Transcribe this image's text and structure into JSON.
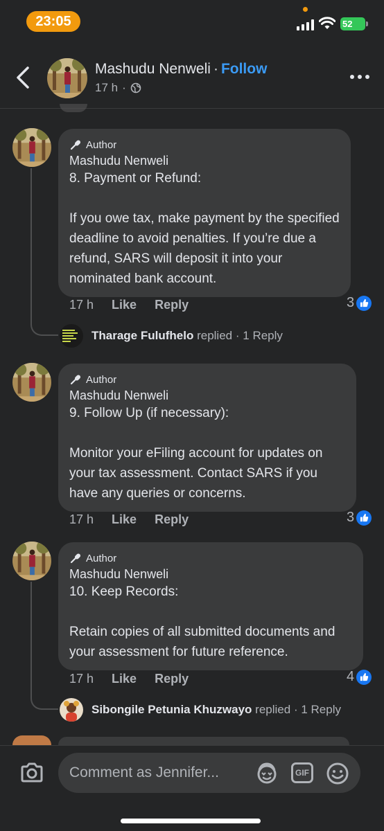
{
  "status_bar": {
    "time": "23:05",
    "battery": "52"
  },
  "header": {
    "name": "Mashudu Nenweli",
    "separator": "·",
    "follow_label": "Follow",
    "time_ago": "17 h",
    "meta_dot": "·",
    "audience_icon": "globe-icon"
  },
  "comments": [
    {
      "badge": "Author",
      "name": "Mashudu Nenweli",
      "text": "8. Payment or Refund:\n\nIf you owe tax, make payment by the specified deadline to avoid penalties. If you’re due a refund, SARS will deposit it into your nominated bank account.",
      "time": "17 h",
      "like_label": "Like",
      "reply_label": "Reply",
      "reactions": "3",
      "reply_summary": {
        "name": "Tharage Fulufhelo",
        "action": "replied",
        "dot": "·",
        "count": "1 Reply"
      }
    },
    {
      "badge": "Author",
      "name": "Mashudu Nenweli",
      "text": "9. Follow Up (if necessary):\n\nMonitor your eFiling account for updates on your tax assessment. Contact SARS if you have any queries or concerns.",
      "time": "17 h",
      "like_label": "Like",
      "reply_label": "Reply",
      "reactions": "3"
    },
    {
      "badge": "Author",
      "name": "Mashudu Nenweli",
      "text": "10. Keep Records:\n\nRetain copies of all submitted documents and your assessment for future reference.",
      "time": "17 h",
      "like_label": "Like",
      "reply_label": "Reply",
      "reactions": "4",
      "reply_summary": {
        "name": "Sibongile Petunia Khuzwayo",
        "action": "replied",
        "dot": "·",
        "count": "1 Reply"
      }
    }
  ],
  "composer": {
    "placeholder": "Comment as Jennifer...",
    "gif_label": "GIF"
  },
  "colors": {
    "accent": "#3b9bf5",
    "like": "#1877f2",
    "time_pill": "#f29a0e",
    "battery": "#34c759"
  }
}
